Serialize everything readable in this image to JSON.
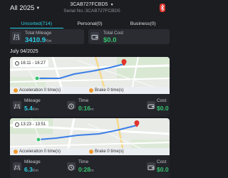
{
  "header": {
    "year_label": "All 2025",
    "device_name": "3CAB727FCBD5",
    "serial_label": "Serial No.:3CAB727FCBD5"
  },
  "tabs": [
    {
      "label": "Unsorted(714)",
      "active": true
    },
    {
      "label": "Personal(0)",
      "active": false
    },
    {
      "label": "Business(0)",
      "active": false
    }
  ],
  "summary": {
    "mileage": {
      "label": "Total Mileage",
      "value": "3410.9",
      "unit": "Km"
    },
    "cost": {
      "label": "Total Cost",
      "value": "$0.0"
    }
  },
  "date_heading": "July 04/2025",
  "trips": [
    {
      "time_range": "16:11 - 16:27",
      "acceleration": "Acceleration 0 time(s)",
      "brake": "Brake 0 time(s)",
      "mileage_label": "Mileage",
      "mileage_value": "5.4",
      "mileage_unit": "Km",
      "time_label": "Time",
      "time_value": "0:16",
      "time_unit": "m",
      "cost_label": "Cost",
      "cost_value": "$0.0"
    },
    {
      "time_range": "13:23 - 13:51",
      "acceleration": "Acceleration 0 time(s)",
      "brake": "Brake 0 time(s)",
      "mileage_label": "Mileage",
      "mileage_value": "6.3",
      "mileage_unit": "Km",
      "time_label": "Time",
      "time_value": "0:28",
      "time_unit": "m",
      "cost_label": "Cost",
      "cost_value": "$0.0"
    }
  ],
  "colors": {
    "background": "#1b1d21",
    "card": "#2a2c31",
    "accent_cyan": "#2bd0e8",
    "accent_green": "#35c46f",
    "event_orange": "#f09a2e",
    "bluetooth_red": "#e0342b"
  },
  "icons": [
    "chevron-down-icon",
    "bluetooth-icon",
    "road-icon",
    "wallet-icon",
    "clock-icon",
    "start-pin-icon",
    "end-pin-icon"
  ]
}
